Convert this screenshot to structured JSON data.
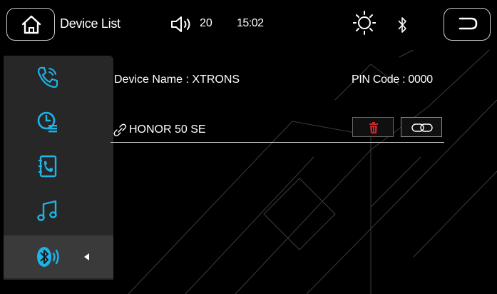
{
  "header": {
    "title": "Device List",
    "volume": "20",
    "time": "15:02"
  },
  "sidebar": {
    "items": [
      {
        "name": "phone-icon"
      },
      {
        "name": "call-log-icon"
      },
      {
        "name": "contacts-icon"
      },
      {
        "name": "music-icon"
      },
      {
        "name": "bluetooth-audio-icon",
        "active": true
      }
    ]
  },
  "main": {
    "device_name": "Device Name : XTRONS",
    "pin_code": "PIN Code : 0000",
    "paired_devices": [
      {
        "name": "HONOR 50 SE"
      }
    ]
  },
  "colors": {
    "accent": "#1fb3e8",
    "delete": "#c0262c",
    "connect_border": "#8a8a8a"
  }
}
